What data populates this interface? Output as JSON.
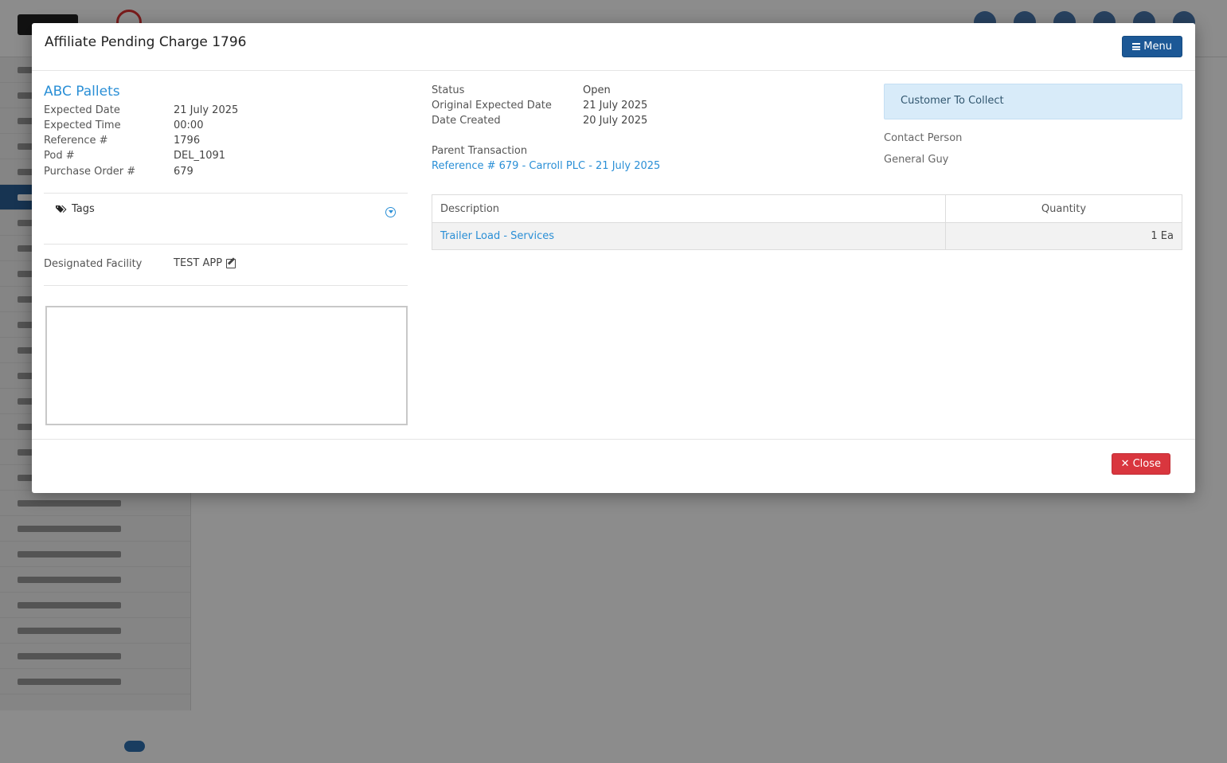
{
  "modal": {
    "title": "Affiliate Pending Charge 1796",
    "menu_label": "Menu",
    "close_label": "Close"
  },
  "summary": {
    "company_name": "ABC Pallets",
    "fields": [
      {
        "label": "Expected Date",
        "value": "21 July 2025"
      },
      {
        "label": "Expected Time",
        "value": "00:00"
      },
      {
        "label": "Reference #",
        "value": "1796"
      },
      {
        "label": "Pod #",
        "value": "DEL_1091"
      },
      {
        "label": "Purchase Order #",
        "value": "679"
      }
    ],
    "tags_label": "Tags",
    "facility_label": "Designated Facility",
    "facility_value": "TEST APP"
  },
  "details": {
    "fields": [
      {
        "label": "Status",
        "value": "Open"
      },
      {
        "label": "Original Expected Date",
        "value": "21 July 2025"
      },
      {
        "label": "Date Created",
        "value": "20 July 2025"
      }
    ],
    "parent_label": "Parent Transaction",
    "parent_link": "Reference # 679 - Carroll PLC - 21 July 2025"
  },
  "collection": {
    "notice": "Customer To Collect",
    "contact_label": "Contact Person",
    "contact_name": "General Guy"
  },
  "items_table": {
    "headers": {
      "description": "Description",
      "quantity": "Quantity"
    },
    "rows": [
      {
        "description": "Trailer Load - Services",
        "quantity": "1 Ea"
      }
    ]
  },
  "colors": {
    "link": "#2a8fd6",
    "menu_button": "#1c5896",
    "close_button": "#d9363e",
    "notice_bg": "#d8ebf9"
  }
}
